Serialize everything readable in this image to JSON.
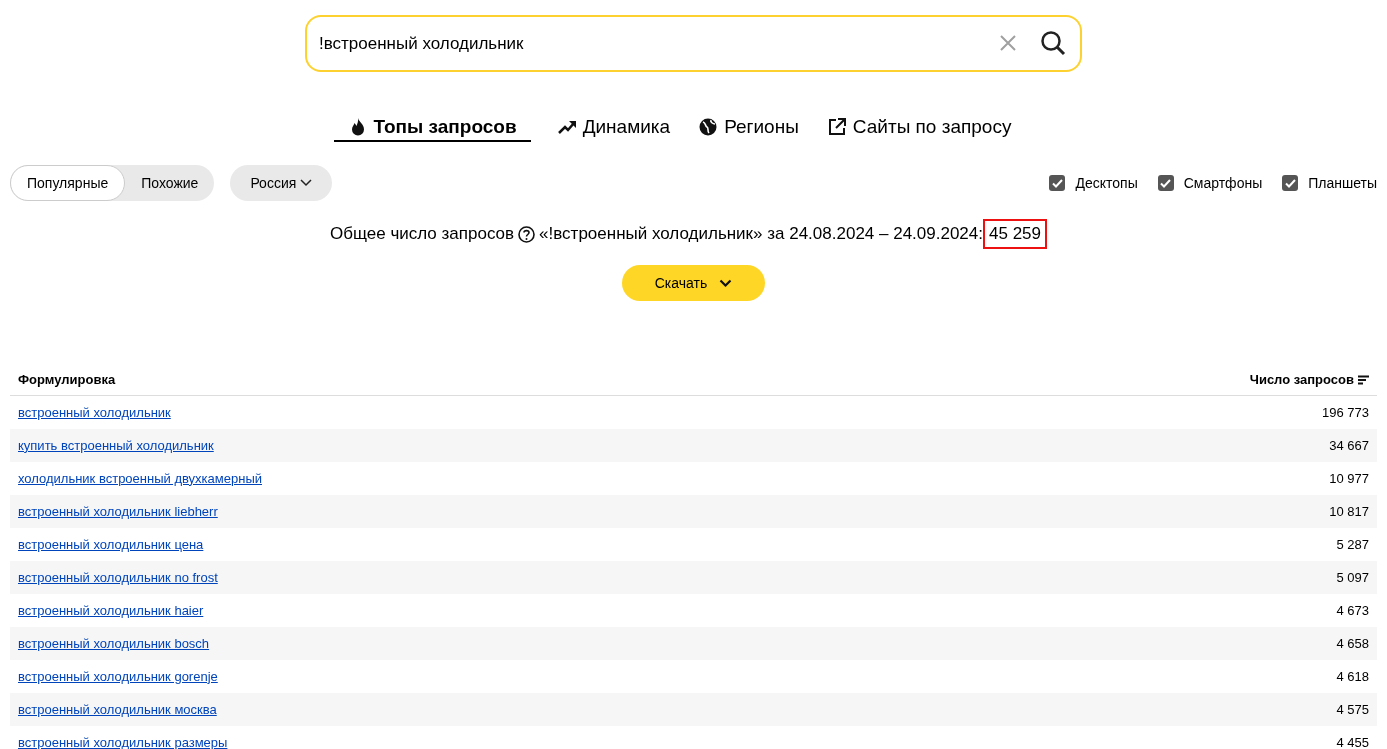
{
  "search": {
    "value": "!встроенный холодильник"
  },
  "tabs": [
    {
      "kind": "fire",
      "label": "Топы запросов",
      "selected": true
    },
    {
      "kind": "trend",
      "label": "Динамика",
      "selected": false
    },
    {
      "kind": "globe",
      "label": "Регионы",
      "selected": false
    },
    {
      "kind": "external",
      "label": "Сайты по запросу",
      "selected": false
    }
  ],
  "mode_toggle": [
    {
      "label": "Популярные",
      "selected": true
    },
    {
      "label": "Похожие",
      "selected": false
    }
  ],
  "region_select": {
    "value": "Россия"
  },
  "devices": [
    {
      "label": "Десктопы",
      "checked": true
    },
    {
      "label": "Смартфоны",
      "checked": true
    },
    {
      "label": "Планшеты",
      "checked": true
    }
  ],
  "summary": {
    "label": "Общее число запросов",
    "period_text": "«!встроенный холодильник» за 24.08.2024 – 24.09.2024:",
    "total": "45 259",
    "total_highlighted": true
  },
  "download_button": {
    "label": "Скачать"
  },
  "table": {
    "columns": [
      "Формулировка",
      "Число запросов"
    ],
    "rows": [
      [
        "встроенный холодильник",
        "196 773"
      ],
      [
        "купить встроенный холодильник",
        "34 667"
      ],
      [
        "холодильник встроенный двухкамерный",
        "10 977"
      ],
      [
        "встроенный холодильник liebherr",
        "10 817"
      ],
      [
        "встроенный холодильник цена",
        "5 287"
      ],
      [
        "встроенный холодильник no frost",
        "5 097"
      ],
      [
        "встроенный холодильник haier",
        "4 673"
      ],
      [
        "встроенный холодильник bosch",
        "4 658"
      ],
      [
        "встроенный холодильник gorenje",
        "4 618"
      ],
      [
        "встроенный холодильник москва",
        "4 575"
      ],
      [
        "встроенный холодильник размеры",
        "4 455"
      ]
    ]
  }
}
